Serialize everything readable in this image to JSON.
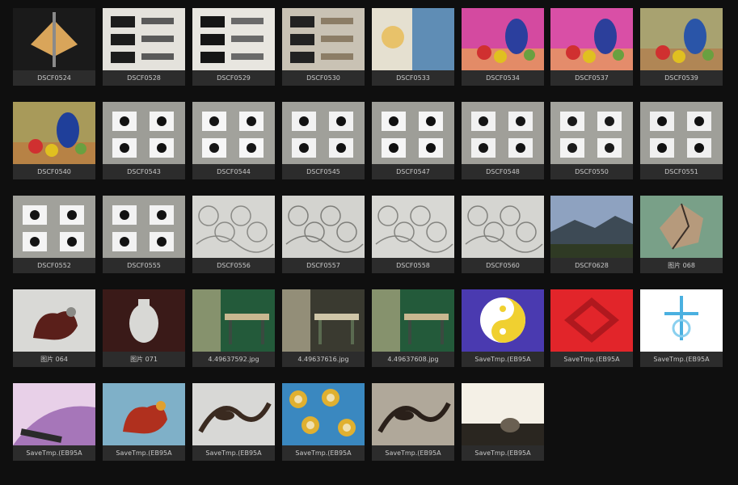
{
  "gallery": {
    "items": [
      {
        "label": "DSCF0524",
        "thumb": "gold-emblem-photo",
        "palette": [
          "#1a1a1a",
          "#d9a55a",
          "#8a8a8a"
        ]
      },
      {
        "label": "DSCF0528",
        "thumb": "chinese-character-sketch",
        "palette": [
          "#e4e2dc",
          "#1c1c1c",
          "#5a5a5a"
        ]
      },
      {
        "label": "DSCF0529",
        "thumb": "chinese-character-sketch",
        "palette": [
          "#e8e6e0",
          "#151515",
          "#6a6a6a"
        ]
      },
      {
        "label": "DSCF0530",
        "thumb": "chinese-character-sketch",
        "palette": [
          "#c9c2b4",
          "#222222",
          "#8c7d66"
        ]
      },
      {
        "label": "DSCF0533",
        "thumb": "poster-photo",
        "palette": [
          "#5f8db5",
          "#e8c26a",
          "#e5e0d0"
        ]
      },
      {
        "label": "DSCF0534",
        "thumb": "still-life-painting",
        "palette": [
          "#d44aa0",
          "#2b3f9e",
          "#f2cc2e"
        ]
      },
      {
        "label": "DSCF0537",
        "thumb": "still-life-painting",
        "palette": [
          "#d94fa6",
          "#2c3f9b",
          "#f0c930"
        ]
      },
      {
        "label": "DSCF0539",
        "thumb": "still-life-painting",
        "palette": [
          "#a8a270",
          "#2a55a8",
          "#b86a3a"
        ]
      },
      {
        "label": "DSCF0540",
        "thumb": "still-life-painting",
        "palette": [
          "#a89a5a",
          "#1f3f9a",
          "#c56a30"
        ]
      },
      {
        "label": "DSCF0543",
        "thumb": "icon-cards-photo",
        "palette": [
          "#9d9d97",
          "#f4f4f4",
          "#111111"
        ]
      },
      {
        "label": "DSCF0544",
        "thumb": "icon-cards-photo",
        "palette": [
          "#a2a29c",
          "#f6f6f6",
          "#151515"
        ]
      },
      {
        "label": "DSCF0545",
        "thumb": "icon-cards-photo",
        "palette": [
          "#a0a09a",
          "#f2f2f2",
          "#121212"
        ]
      },
      {
        "label": "DSCF0547",
        "thumb": "icon-cards-photo",
        "palette": [
          "#9e9e98",
          "#f5f5f5",
          "#101010"
        ]
      },
      {
        "label": "DSCF0548",
        "thumb": "icon-cards-photo",
        "palette": [
          "#a09f99",
          "#f1f1f1",
          "#141414"
        ]
      },
      {
        "label": "DSCF0550",
        "thumb": "icon-cards-photo",
        "palette": [
          "#a3a39d",
          "#f3f3f3",
          "#1a1a1a"
        ]
      },
      {
        "label": "DSCF0551",
        "thumb": "icon-cards-photo",
        "palette": [
          "#9f9f99",
          "#f0f0f0",
          "#111111"
        ]
      },
      {
        "label": "DSCF0552",
        "thumb": "icon-cards-photo",
        "palette": [
          "#a1a19b",
          "#f4f4f4",
          "#131313"
        ]
      },
      {
        "label": "DSCF0555",
        "thumb": "icon-cards-photo",
        "palette": [
          "#a0a09a",
          "#f2f2f2",
          "#121212"
        ]
      },
      {
        "label": "DSCF0556",
        "thumb": "ornament-sketch",
        "palette": [
          "#d6d6d2",
          "#8a8a86",
          "#bdbdb8"
        ]
      },
      {
        "label": "DSCF0557",
        "thumb": "ornament-sketch",
        "palette": [
          "#d3d3cf",
          "#7e7e7a",
          "#b8b8b3"
        ]
      },
      {
        "label": "DSCF0558",
        "thumb": "ornament-sketch",
        "palette": [
          "#d8d8d4",
          "#848480",
          "#bcbcb7"
        ]
      },
      {
        "label": "DSCF0560",
        "thumb": "ornament-sketch",
        "palette": [
          "#d5d5d1",
          "#82827e",
          "#babab5"
        ]
      },
      {
        "label": "DSCF0628",
        "thumb": "mountain-landscape-photo",
        "palette": [
          "#8ea2c0",
          "#3d4a55",
          "#2f3a24"
        ]
      },
      {
        "label": "图片 068",
        "thumb": "faceted-sculpture-photo",
        "palette": [
          "#79a088",
          "#b69a7c",
          "#3a2f28"
        ]
      },
      {
        "label": "图片 064",
        "thumb": "rooster-papercut-photo",
        "palette": [
          "#d9d9d6",
          "#5a1f1a",
          "#8a8a86"
        ]
      },
      {
        "label": "图片 071",
        "thumb": "vase-papercut-photo",
        "palette": [
          "#3a1a18",
          "#d8d8d5",
          "#c9a070"
        ]
      },
      {
        "label": "4.49637592.jpg",
        "thumb": "classroom-photo",
        "palette": [
          "#235a3a",
          "#c8b890",
          "#3a4a40"
        ]
      },
      {
        "label": "4.49637616.jpg",
        "thumb": "classroom-photo",
        "palette": [
          "#3a3a30",
          "#cfc6a8",
          "#5a6a50"
        ]
      },
      {
        "label": "4.49637608.jpg",
        "thumb": "classroom-photo",
        "palette": [
          "#235a3a",
          "#c8b890",
          "#3a4a40"
        ]
      },
      {
        "label": "SaveTmp.(EB95A",
        "thumb": "yin-yang-art",
        "palette": [
          "#4a3ab0",
          "#f0d030",
          "#ffffff"
        ]
      },
      {
        "label": "SaveTmp.(EB95A",
        "thumb": "red-pattern-art",
        "palette": [
          "#e2252a",
          "#f4e6c8",
          "#b0181e"
        ]
      },
      {
        "label": "SaveTmp.(EB95A",
        "thumb": "blue-ornament-art",
        "palette": [
          "#ffffff",
          "#4ab0e0",
          "#8ad0ef"
        ]
      },
      {
        "label": "SaveTmp.(EB95A",
        "thumb": "colorful-abstract-art",
        "palette": [
          "#e8d0e8",
          "#7a3a9a",
          "#2a2a2a"
        ]
      },
      {
        "label": "SaveTmp.(EB95A",
        "thumb": "rooster-folk-art",
        "palette": [
          "#7fb0c8",
          "#b0301e",
          "#e0a030"
        ]
      },
      {
        "label": "SaveTmp.(EB95A",
        "thumb": "bird-silhouette-photo",
        "palette": [
          "#d8d8d6",
          "#3a2a20",
          "#9a9a96"
        ]
      },
      {
        "label": "SaveTmp.(EB95A",
        "thumb": "flower-fabric-photo",
        "palette": [
          "#3a88c0",
          "#e0b030",
          "#f0e0b0"
        ]
      },
      {
        "label": "SaveTmp.(EB95A",
        "thumb": "shadow-leaves-photo",
        "palette": [
          "#b0a89a",
          "#2a201a",
          "#6a8ab0"
        ]
      },
      {
        "label": "SaveTmp.(EB95A",
        "thumb": "bright-window-photo",
        "palette": [
          "#f4f0e6",
          "#6a6052",
          "#2a2620"
        ]
      }
    ]
  }
}
